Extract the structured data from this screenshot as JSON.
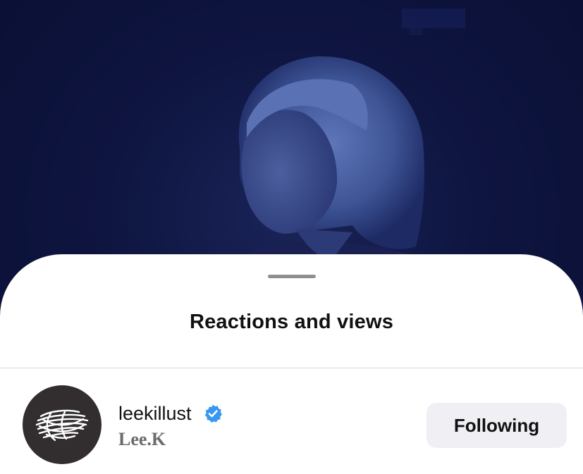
{
  "sheet": {
    "title": "Reactions and views"
  },
  "viewer": {
    "username": "leekillust",
    "display_name": "Lee.K",
    "verified": true,
    "follow_label": "Following",
    "avatar_icon": "scribble-logo-icon"
  },
  "colors": {
    "background_overlay": "#0d1238",
    "sheet": "#ffffff",
    "verified_badge": "#3897f0",
    "button_bg": "#efeff4",
    "avatar_bg": "#322e2f"
  }
}
